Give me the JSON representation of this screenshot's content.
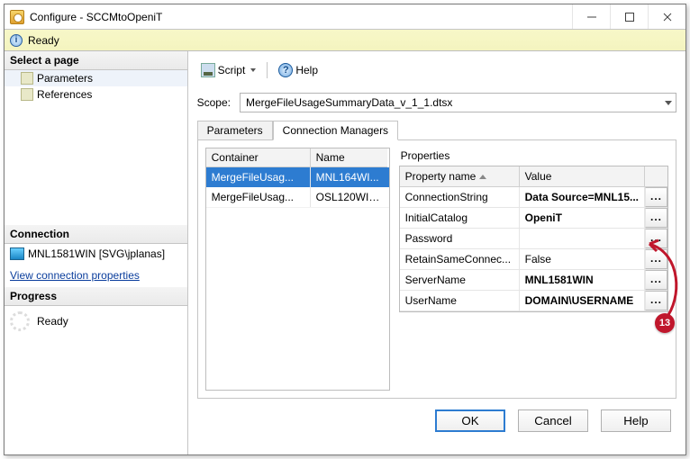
{
  "window": {
    "title": "Configure - SCCMtoOpeniT"
  },
  "status": {
    "text": "Ready"
  },
  "sidebar": {
    "pages_header": "Select a page",
    "pages": [
      {
        "label": "Parameters"
      },
      {
        "label": "References"
      }
    ],
    "conn_header": "Connection",
    "connection": "MNL1581WIN [SVG\\jplanas]",
    "view_conn_link": "View connection properties",
    "progress_header": "Progress",
    "progress_text": "Ready"
  },
  "toolbar": {
    "script": "Script",
    "help": "Help"
  },
  "scope": {
    "label": "Scope:",
    "value": "MergeFileUsageSummaryData_v_1_1.dtsx"
  },
  "tabs": {
    "parameters": "Parameters",
    "connmgrs": "Connection Managers"
  },
  "conn_grid": {
    "col_container": "Container",
    "col_name": "Name",
    "rows": [
      {
        "container": "MergeFileUsag...",
        "name": "MNL164WI..."
      },
      {
        "container": "MergeFileUsag...",
        "name": "OSL120WIN..."
      }
    ]
  },
  "properties": {
    "title": "Properties",
    "col_name": "Property name",
    "col_value": "Value",
    "rows": [
      {
        "name": "ConnectionString",
        "value": "Data Source=MNL15...",
        "bold": true
      },
      {
        "name": "InitialCatalog",
        "value": "OpeniT",
        "bold": true
      },
      {
        "name": "Password",
        "value": "",
        "bold": false
      },
      {
        "name": "RetainSameConnec...",
        "value": "False",
        "bold": false
      },
      {
        "name": "ServerName",
        "value": "MNL1581WIN",
        "bold": true
      },
      {
        "name": "UserName",
        "value": "DOMAIN\\USERNAME",
        "bold": true
      }
    ]
  },
  "buttons": {
    "ok": "OK",
    "cancel": "Cancel",
    "help": "Help"
  },
  "annotation": {
    "number": "13"
  }
}
